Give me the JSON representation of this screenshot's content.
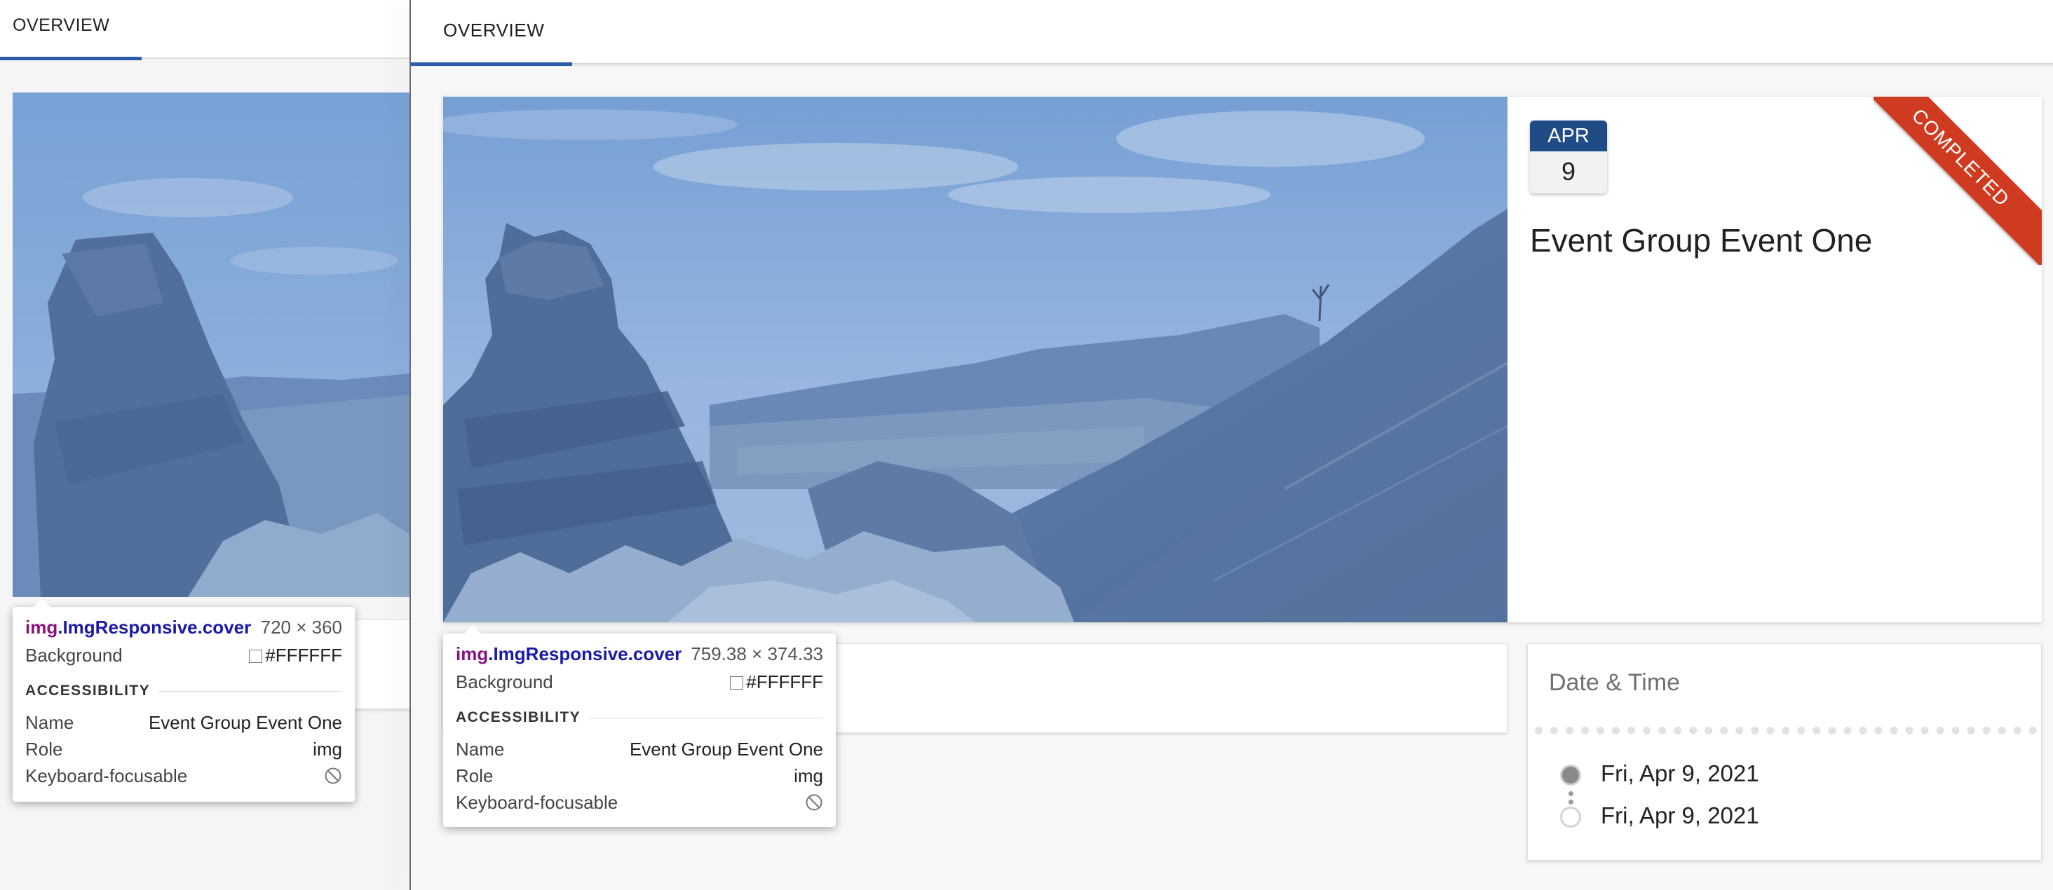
{
  "left_panel": {
    "tab": {
      "label": "OVERVIEW"
    }
  },
  "main": {
    "tab": {
      "label": "OVERVIEW"
    },
    "event": {
      "month": "APR",
      "day": "9",
      "title": "Event Group Event One",
      "status_ribbon": "COMPLETED"
    },
    "date_time": {
      "title": "Date & Time",
      "start": "Fri, Apr 9, 2021",
      "end": "Fri, Apr 9, 2021"
    }
  },
  "tooltips": [
    {
      "tag": "img",
      "class_name": ".ImgResponsive.cover",
      "size": "720 × 360",
      "background_label": "Background",
      "background_value": "#FFFFFF",
      "section": "ACCESSIBILITY",
      "name_label": "Name",
      "name_value": "Event Group Event One",
      "role_label": "Role",
      "role_value": "img",
      "focus_label": "Keyboard-focusable",
      "focus_icon": "not-allowed-icon"
    },
    {
      "tag": "img",
      "class_name": ".ImgResponsive.cover",
      "size": "759.38 × 374.33",
      "background_label": "Background",
      "background_value": "#FFFFFF",
      "section": "ACCESSIBILITY",
      "name_label": "Name",
      "name_value": "Event Group Event One",
      "role_label": "Role",
      "role_value": "img",
      "focus_label": "Keyboard-focusable",
      "focus_icon": "not-allowed-icon"
    }
  ],
  "colors": {
    "accent_blue": "#2a5da8",
    "badge_month_bg": "#1f4b86",
    "ribbon_red": "#cf3b20",
    "image_overlay": "#5b8ccf",
    "devtools_tag": "#881280",
    "devtools_class": "#1a1aa6"
  }
}
